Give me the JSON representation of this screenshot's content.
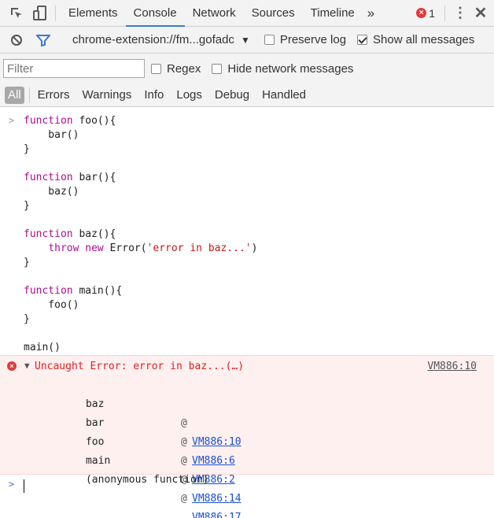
{
  "tabs": {
    "items": [
      "Elements",
      "Console",
      "Network",
      "Sources",
      "Timeline"
    ],
    "active": "Console",
    "error_count": "1"
  },
  "subbar": {
    "context": "chrome-extension://fm...gofadc",
    "preserve_log": "Preserve log",
    "show_all": "Show all messages"
  },
  "filterbar": {
    "placeholder": "Filter",
    "regex": "Regex",
    "hide_network": "Hide network messages"
  },
  "levels": [
    "All",
    "Errors",
    "Warnings",
    "Info",
    "Logs",
    "Debug",
    "Handled"
  ],
  "console": {
    "code_lines": [
      "function foo(){",
      "    bar()",
      "}",
      "",
      "function bar(){",
      "    baz()",
      "}",
      "",
      "function baz(){",
      "    throw new Error('error in baz...')",
      "}",
      "",
      "function main(){",
      "    foo()",
      "}",
      "",
      "main()"
    ],
    "error": {
      "message": "Uncaught Error: error in baz...(…)",
      "source": "VM886:10",
      "frames": [
        {
          "fn": "baz",
          "loc": "VM886:10"
        },
        {
          "fn": "bar",
          "loc": "VM886:6"
        },
        {
          "fn": "foo",
          "loc": "VM886:2"
        },
        {
          "fn": "main",
          "loc": "VM886:14"
        },
        {
          "fn": "(anonymous function)",
          "loc": "VM886:17"
        }
      ]
    }
  },
  "colors": {
    "accent": "#3879d9",
    "error": "#e02020",
    "error_bg": "#fff0f0"
  }
}
